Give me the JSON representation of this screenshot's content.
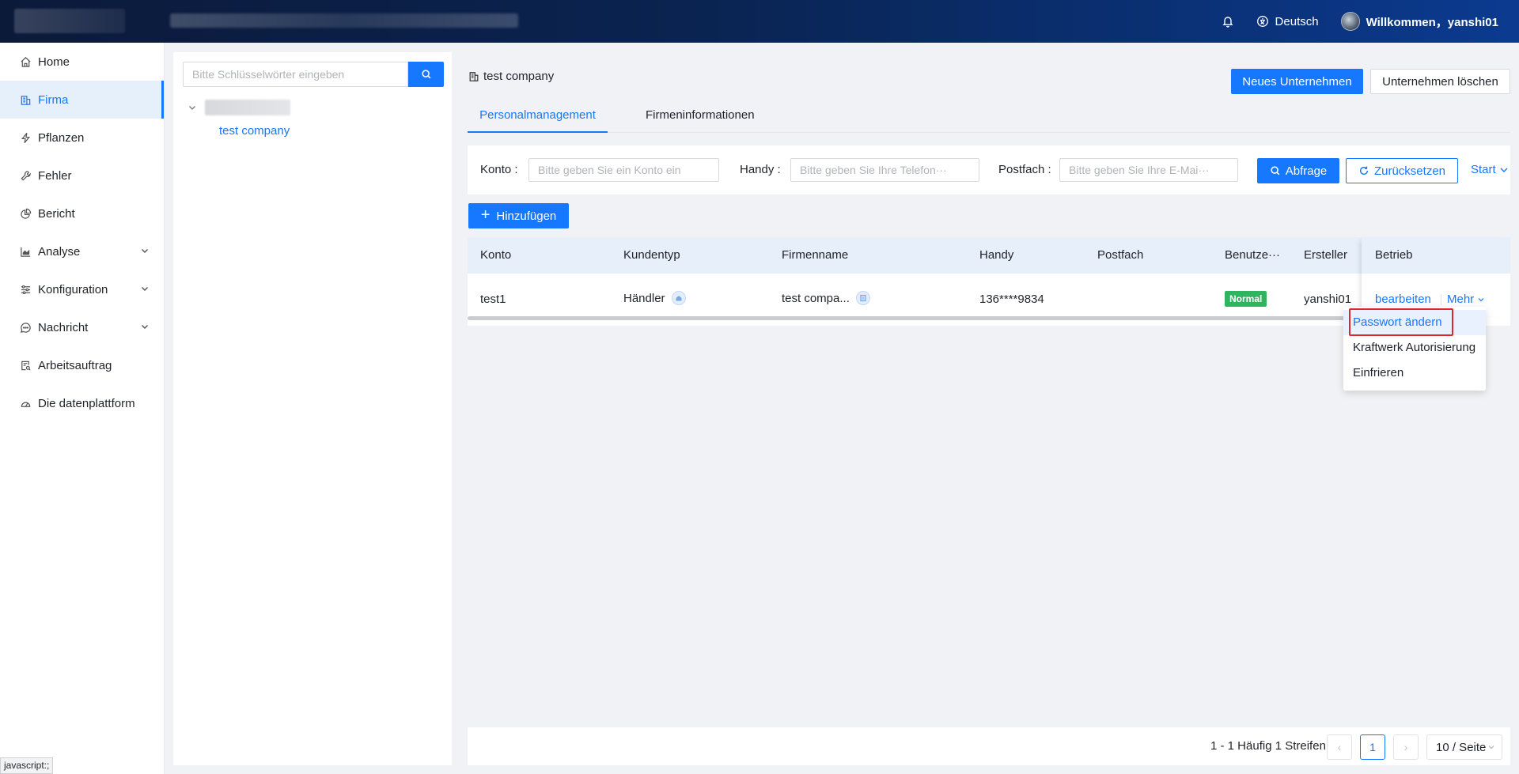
{
  "header": {
    "notifications_icon": "bell-icon",
    "language_icon": "globe-icon",
    "language": "Deutsch",
    "welcome": "Willkommen，yanshi01"
  },
  "sidebar": {
    "items": [
      {
        "label": "Home",
        "icon": "home-icon",
        "active": false,
        "expandable": false
      },
      {
        "label": "Firma",
        "icon": "building-icon",
        "active": true,
        "expandable": false
      },
      {
        "label": "Pflanzen",
        "icon": "lightning-icon",
        "active": false,
        "expandable": false
      },
      {
        "label": "Fehler",
        "icon": "wrench-icon",
        "active": false,
        "expandable": false
      },
      {
        "label": "Bericht",
        "icon": "pie-chart-icon",
        "active": false,
        "expandable": false
      },
      {
        "label": "Analyse",
        "icon": "area-chart-icon",
        "active": false,
        "expandable": true
      },
      {
        "label": "Konfiguration",
        "icon": "sliders-icon",
        "active": false,
        "expandable": true
      },
      {
        "label": "Nachricht",
        "icon": "message-icon",
        "active": false,
        "expandable": true
      },
      {
        "label": "Arbeitsauftrag",
        "icon": "file-search-icon",
        "active": false,
        "expandable": false
      },
      {
        "label": "Die datenplattform",
        "icon": "dashboard-icon",
        "active": false,
        "expandable": false
      }
    ]
  },
  "tree": {
    "search_placeholder": "Bitte Schlüsselwörter eingeben",
    "child_node": "test company"
  },
  "main": {
    "company_name": "test company",
    "new_company_button": "Neues Unternehmen",
    "delete_company_button": "Unternehmen löschen",
    "tabs": [
      {
        "label": "Personalmanagement",
        "active": true
      },
      {
        "label": "Firmeninformationen",
        "active": false
      }
    ]
  },
  "filters": {
    "account_label": "Konto",
    "account_placeholder": "Bitte geben Sie ein Konto ein",
    "phone_label": "Handy",
    "phone_placeholder": "Bitte geben Sie Ihre Telefon···",
    "email_label": "Postfach",
    "email_placeholder": "Bitte geben Sie Ihre E-Mai···",
    "query_button": "Abfrage",
    "reset_button": "Zurücksetzen",
    "expand_link": "Start"
  },
  "add_button": "Hinzufügen",
  "table": {
    "columns": [
      "Konto",
      "Kundentyp",
      "Firmenname",
      "Handy",
      "Postfach",
      "Benutze···",
      "Ersteller",
      "Betrieb"
    ],
    "rows": [
      {
        "account": "test1",
        "customer_type": "Händler",
        "company": "test compa...",
        "phone": "136****9834",
        "email": "",
        "user_status": "Normal",
        "creator": "yanshi01",
        "edit": "bearbeiten",
        "more": "Mehr"
      }
    ]
  },
  "more_menu": {
    "items": [
      "Passwort ändern",
      "Kraftwerk Autorisierung",
      "Einfrieren"
    ],
    "highlighted_index": 0,
    "highlight_color": "#e0252b"
  },
  "pagination": {
    "summary": "1 - 1 Häufig 1 Streifen",
    "current_page": "1",
    "page_size": "10 / Seite"
  },
  "statusbar": "javascript:;",
  "colors": {
    "primary": "#1677ff",
    "success_tag": "#31b460",
    "header_bg_start": "#0c1a3a",
    "header_bg_end": "#0b3a8f"
  }
}
